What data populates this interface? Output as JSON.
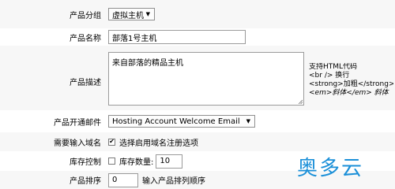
{
  "form": {
    "product_group": {
      "label": "产品分组",
      "value": "虚拟主机"
    },
    "product_name": {
      "label": "产品名称",
      "value": "部落1号主机"
    },
    "product_desc": {
      "label": "产品描述",
      "value": "来自部落的精品主机",
      "hint_lines": [
        "支持HTML代码",
        "<br /> 换行",
        "<strong>加粗</strong>",
        "<em>斜体</em> 斜体"
      ]
    },
    "welcome_email": {
      "label": "产品开通邮件",
      "value": "Hosting Account Welcome Email"
    },
    "require_domain": {
      "label": "需要输入域名",
      "checkbox_label": "选择启用域名注册选项",
      "checked": true
    },
    "stock_control": {
      "label": "库存控制",
      "checkbox_label": "库存数量:",
      "checked": false,
      "quantity": "10"
    },
    "sort_order": {
      "label": "产品排序",
      "value": "0",
      "hint": "输入产品排列顺序"
    }
  },
  "watermark": "奥多云",
  "colors": {
    "row_alt": "#f7f7f7",
    "watermark": "#1a8fd8"
  }
}
